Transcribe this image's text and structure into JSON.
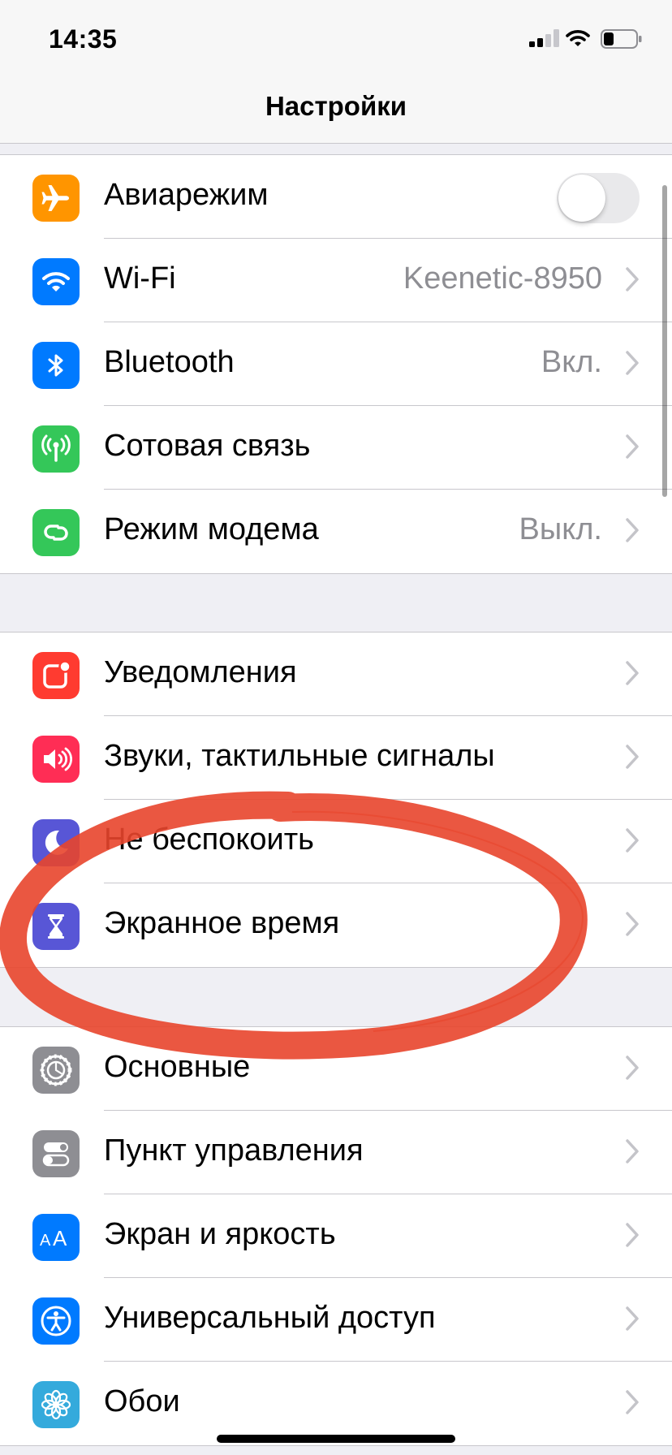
{
  "status_bar": {
    "time": "14:35"
  },
  "nav": {
    "title": "Настройки"
  },
  "groups": [
    {
      "rows": [
        {
          "label": "Авиарежим",
          "icon": "airplane-icon",
          "color": "#ff9500",
          "toggle": false
        },
        {
          "label": "Wi-Fi",
          "value": "Keenetic-8950",
          "icon": "wifi-icon",
          "color": "#007aff"
        },
        {
          "label": "Bluetooth",
          "value": "Вкл.",
          "icon": "bluetooth-icon",
          "color": "#007aff"
        },
        {
          "label": "Сотовая связь",
          "value": "",
          "icon": "antenna-icon",
          "color": "#34c759"
        },
        {
          "label": "Режим модема",
          "value": "Выкл.",
          "icon": "personal-hotspot-icon",
          "color": "#34c759"
        }
      ]
    },
    {
      "rows": [
        {
          "label": "Уведомления",
          "icon": "notifications-icon",
          "color": "#ff3b30"
        },
        {
          "label": "Звуки, тактильные сигналы",
          "icon": "speaker-icon",
          "color": "#ff2d55"
        },
        {
          "label": "Не беспокоить",
          "icon": "moon-icon",
          "color": "#5856d6"
        },
        {
          "label": "Экранное время",
          "icon": "hourglass-icon",
          "color": "#5856d6"
        }
      ]
    },
    {
      "rows": [
        {
          "label": "Основные",
          "icon": "gear-icon",
          "color": "#8e8e93"
        },
        {
          "label": "Пункт управления",
          "icon": "switches-icon",
          "color": "#8e8e93"
        },
        {
          "label": "Экран и яркость",
          "icon": "text-size-icon",
          "color": "#007aff"
        },
        {
          "label": "Универсальный доступ",
          "icon": "accessibility-icon",
          "color": "#007aff"
        },
        {
          "label": "Обои",
          "icon": "flower-icon",
          "color": "#34aadc"
        }
      ]
    }
  ],
  "annotation": {
    "color": "#e8452c",
    "shape": "hand-drawn ellipse"
  }
}
